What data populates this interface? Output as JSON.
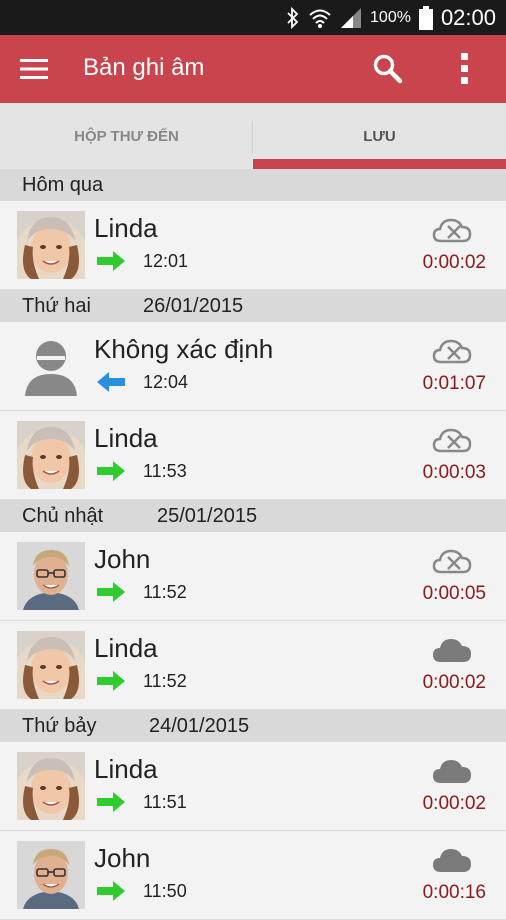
{
  "status_bar": {
    "battery": "100%",
    "time": "02:00",
    "icons": [
      "bluetooth-icon",
      "wifi-icon",
      "signal-icon",
      "battery-icon"
    ]
  },
  "app_bar": {
    "title": "Bản ghi âm",
    "icons": [
      "menu-icon",
      "search-icon",
      "more-vert-icon"
    ]
  },
  "tabs": [
    {
      "label": "HỘP THƯ ĐẾN",
      "selected": false
    },
    {
      "label": "LƯU",
      "selected": true
    }
  ],
  "colors": {
    "accent": "#c9444c",
    "duration": "#8b1a1a",
    "outgoing": "#2ecc2e",
    "incoming": "#2b8fe0"
  },
  "groups": [
    {
      "day": "Hôm qua",
      "date": "",
      "calls": [
        {
          "name": "Linda",
          "avatar": "female",
          "direction": "outgoing",
          "time": "12:01",
          "cloud": "not-synced",
          "duration": "0:00:02"
        }
      ]
    },
    {
      "day": "Thứ hai",
      "date": "26/01/2015",
      "calls": [
        {
          "name": "Không xác định",
          "avatar": "unknown",
          "direction": "incoming",
          "time": "12:04",
          "cloud": "not-synced",
          "duration": "0:01:07"
        },
        {
          "name": "Linda",
          "avatar": "female",
          "direction": "outgoing",
          "time": "11:53",
          "cloud": "not-synced",
          "duration": "0:00:03"
        }
      ]
    },
    {
      "day": "Chủ nhật",
      "date": "25/01/2015",
      "calls": [
        {
          "name": "John",
          "avatar": "male",
          "direction": "outgoing",
          "time": "11:52",
          "cloud": "not-synced",
          "duration": "0:00:05"
        },
        {
          "name": "Linda",
          "avatar": "female",
          "direction": "outgoing",
          "time": "11:52",
          "cloud": "synced",
          "duration": "0:00:02"
        }
      ]
    },
    {
      "day": "Thứ bảy",
      "date": "24/01/2015",
      "calls": [
        {
          "name": "Linda",
          "avatar": "female",
          "direction": "outgoing",
          "time": "11:51",
          "cloud": "synced",
          "duration": "0:00:02"
        },
        {
          "name": "John",
          "avatar": "male",
          "direction": "outgoing",
          "time": "11:50",
          "cloud": "synced",
          "duration": "0:00:16"
        }
      ]
    }
  ]
}
